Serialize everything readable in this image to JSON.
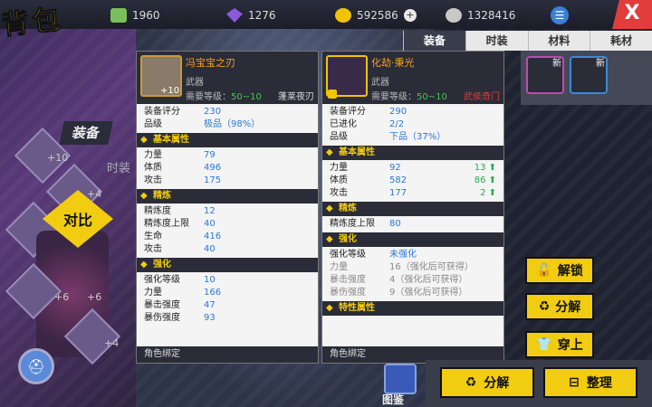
{
  "header": {
    "title": "背包",
    "resources": [
      {
        "name": "cash",
        "value": "1960"
      },
      {
        "name": "crystal",
        "value": "1276"
      },
      {
        "name": "gold",
        "value": "592586"
      },
      {
        "name": "coin",
        "value": "1328416"
      }
    ],
    "close": "X"
  },
  "tabs": [
    "装备",
    "时装",
    "材料",
    "耗材"
  ],
  "left": {
    "equip_label": "装备",
    "compare_label": "对比",
    "shizhuang": "时装",
    "plus_labels": [
      "+10",
      "+4",
      "+4",
      "+6",
      "+6",
      "+4"
    ],
    "chart_label": "图鉴"
  },
  "right_slots_new": [
    "新",
    "新"
  ],
  "panel_left": {
    "name": "冯宝宝之刃",
    "plus": "+10",
    "type": "武器",
    "req_label": "需要等级：",
    "req_value": "50~10",
    "tag": "蓬莱夜刃",
    "stats": [
      {
        "k": "装备评分",
        "v": "230"
      },
      {
        "k": "品级",
        "v": "极品（98%）"
      }
    ],
    "base_title": "基本属性",
    "base": [
      {
        "k": "力量",
        "v": "79"
      },
      {
        "k": "体质",
        "v": "496"
      },
      {
        "k": "攻击",
        "v": "175"
      }
    ],
    "refine_title": "精炼",
    "refine": [
      {
        "k": "精炼度",
        "v": "12"
      },
      {
        "k": "精炼度上限",
        "v": "40"
      },
      {
        "k": "生命",
        "v": "416"
      },
      {
        "k": "攻击",
        "v": "40"
      }
    ],
    "enhance_title": "强化",
    "enhance": [
      {
        "k": "强化等级",
        "v": "10"
      },
      {
        "k": "力量",
        "v": "166"
      },
      {
        "k": "暴击强度",
        "v": "47"
      },
      {
        "k": "暴伤强度",
        "v": "93"
      }
    ],
    "footer": "角色绑定"
  },
  "panel_right": {
    "name": "化劫·秉光",
    "type": "武器",
    "req_label": "需要等级：",
    "req_value": "50~10",
    "tag": "武侯奇门",
    "stats": [
      {
        "k": "装备评分",
        "v": "290"
      },
      {
        "k": "已进化",
        "v": "2/2"
      },
      {
        "k": "品级",
        "v": "下品（37%）"
      }
    ],
    "base_title": "基本属性",
    "base": [
      {
        "k": "力量",
        "v": "92",
        "d": "13 ⬆"
      },
      {
        "k": "体质",
        "v": "582",
        "d": "86 ⬆"
      },
      {
        "k": "攻击",
        "v": "177",
        "d": "2 ⬆"
      }
    ],
    "refine_title": "精炼",
    "refine": [
      {
        "k": "精炼度上限",
        "v": "80"
      }
    ],
    "enhance_title": "强化",
    "enhance": [
      {
        "k": "强化等级",
        "v": "未强化"
      },
      {
        "k": "力量",
        "v": "16（强化后可获得）"
      },
      {
        "k": "暴击强度",
        "v": "4（强化后可获得）"
      },
      {
        "k": "暴伤强度",
        "v": "9（强化后可获得）"
      }
    ],
    "trait_title": "特性属性",
    "footer": "角色绑定"
  },
  "actions": {
    "unlock": "解锁",
    "decompose": "分解",
    "wear": "穿上",
    "bulk_decompose": "分解",
    "organize": "整理"
  },
  "colors": {
    "accent": "#f2cc10",
    "value_blue": "#2a78d6",
    "up_green": "#2aa84a",
    "tag_red": "#e23c3c"
  }
}
